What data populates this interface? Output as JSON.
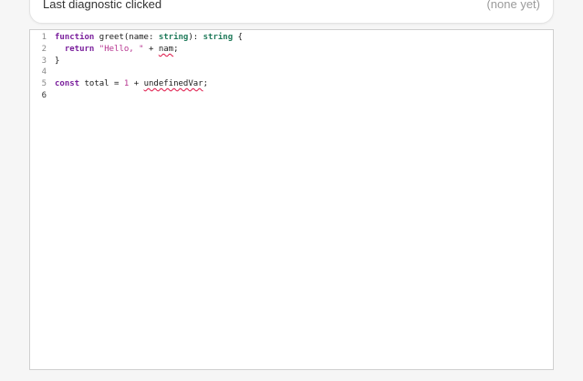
{
  "status": {
    "label": "Last diagnostic clicked",
    "value": "(none yet)"
  },
  "editor": {
    "line_numbers": [
      "1",
      "2",
      "3",
      "4",
      "5",
      "6"
    ],
    "lines": [
      {
        "tokens": [
          {
            "text": "function",
            "kind": "kw"
          },
          {
            "text": " greet(",
            "kind": "plain"
          },
          {
            "text": "name",
            "kind": "plain"
          },
          {
            "text": ": ",
            "kind": "plain"
          },
          {
            "text": "string",
            "kind": "ty"
          },
          {
            "text": "): ",
            "kind": "plain"
          },
          {
            "text": "string",
            "kind": "ty"
          },
          {
            "text": " {",
            "kind": "plain"
          }
        ]
      },
      {
        "tokens": [
          {
            "text": "  ",
            "kind": "plain"
          },
          {
            "text": "return",
            "kind": "kw"
          },
          {
            "text": " ",
            "kind": "plain"
          },
          {
            "text": "\"Hello, \"",
            "kind": "str"
          },
          {
            "text": " + ",
            "kind": "plain"
          },
          {
            "text": "nam",
            "kind": "err"
          },
          {
            "text": ";",
            "kind": "plain"
          }
        ]
      },
      {
        "tokens": [
          {
            "text": "}",
            "kind": "plain"
          }
        ]
      },
      {
        "tokens": []
      },
      {
        "tokens": [
          {
            "text": "const",
            "kind": "kw"
          },
          {
            "text": " total = ",
            "kind": "plain"
          },
          {
            "text": "1",
            "kind": "num"
          },
          {
            "text": " + ",
            "kind": "plain"
          },
          {
            "text": "undefinedVar",
            "kind": "err"
          },
          {
            "text": ";",
            "kind": "plain"
          }
        ]
      },
      {
        "tokens": []
      }
    ],
    "colors": {
      "keyword": "#7a1f9c",
      "type": "#1f7a5a",
      "string": "#b6338f",
      "error_underline": "#d14"
    }
  }
}
